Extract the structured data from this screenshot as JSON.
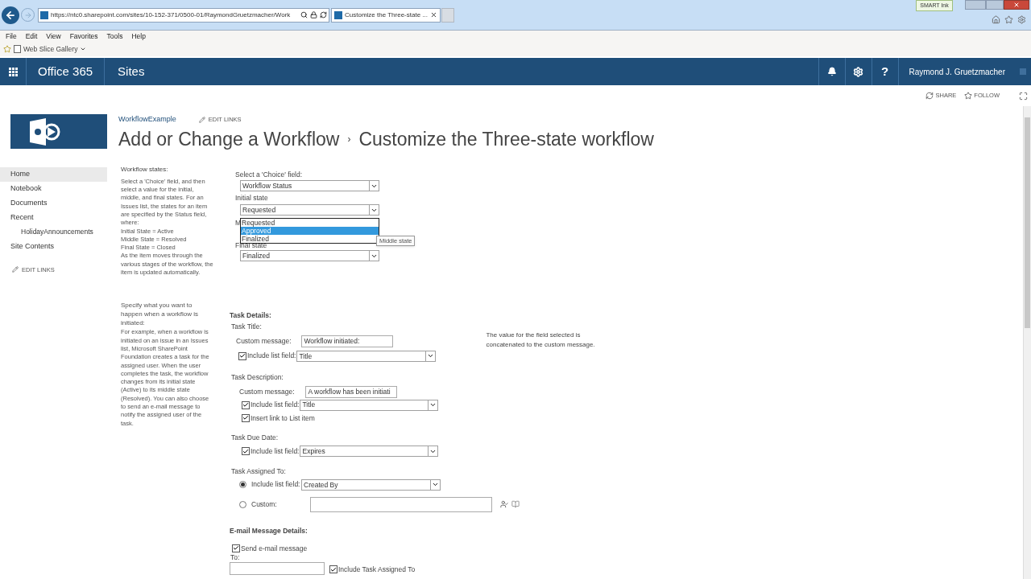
{
  "browser": {
    "url": "https://ntc0.sharepoint.com/sites/10-152-371/0500-01/RaymondGruetzmacher/Work",
    "tab_title": "Customize the Three-state ...",
    "smart_ink": "SMART Ink",
    "menu": [
      "File",
      "Edit",
      "View",
      "Favorites",
      "Tools",
      "Help"
    ],
    "favorites_item": "Web Slice Gallery"
  },
  "suite_bar": {
    "brand": "Office 365",
    "app": "Sites",
    "help": "?",
    "user": "Raymond J. Gruetzmacher"
  },
  "actions": [
    {
      "kind": "share",
      "label": "SHARE"
    },
    {
      "kind": "follow",
      "label": "FOLLOW"
    }
  ],
  "header": {
    "breadcrumb": "WorkflowExample",
    "edit_links": "EDIT LINKS",
    "title": "Add or Change a Workflow",
    "separator": "›",
    "subtitle": "Customize the Three-state workflow"
  },
  "nav": {
    "items": [
      {
        "label": "Home",
        "selected": true
      },
      {
        "label": "Notebook",
        "selected": false
      },
      {
        "label": "Documents",
        "selected": false
      },
      {
        "label": "Recent",
        "selected": false,
        "children": [
          {
            "label": "HolidayAnnouncements",
            "selected": false
          }
        ]
      },
      {
        "label": "Site Contents",
        "selected": false
      }
    ],
    "edit_links": "EDIT LINKS"
  },
  "states_section": {
    "heading": "Workflow states:",
    "description": [
      "Select a 'Choice' field, and then select a value for the initial, middle, and final states. For an Issues list, the states for an item are specified by the Status field, where:",
      "Initial State = Active",
      "Middle State = Resolved",
      "Final State = Closed",
      "As the item moves through the various stages of the workflow, the item is updated automatically."
    ],
    "choice_label": "Select a 'Choice' field:",
    "choice_value": "Workflow Status",
    "initial_label": "Initial state",
    "initial_value": "Requested",
    "middle_label": "M",
    "middle_options": [
      {
        "label": "Requested",
        "selected": false
      },
      {
        "label": "Approved",
        "selected": true
      },
      {
        "label": "Finalized",
        "selected": false
      }
    ],
    "tooltip": "Middle state",
    "final_label": "Final state",
    "final_value": "Finalized"
  },
  "task_section": {
    "intro": "Specify what you want to happen when a workflow is initiated:",
    "description": "For example, when a workflow is initiated on an issue in an Issues list, Microsoft SharePoint Foundation creates a task for the assigned user. When the user completes the task, the workflow changes from its initial state (Active) to its middle state (Resolved). You can also choose to send an e-mail message to notify the assigned user of the task.",
    "heading": "Task Details:",
    "task_title": {
      "label": "Task Title:",
      "message_label": "Custom message:",
      "message_value": "Workflow initiated:",
      "note": "The value for the field selected is concatenated to the custom message.",
      "include_label": "Include list field:",
      "include_checked": true,
      "include_value": "Title"
    },
    "task_description": {
      "label": "Task Description:",
      "message_label": "Custom message:",
      "message_value": "A workflow has been initiati",
      "include_label": "Include list field:",
      "include_checked": true,
      "include_value": "Title",
      "link_label": "Insert link to List item",
      "link_checked": true
    },
    "due_date": {
      "label": "Task Due Date:",
      "include_label": "Include list field:",
      "include_checked": true,
      "include_value": "Expires"
    },
    "assigned_to": {
      "label": "Task Assigned To:",
      "options": [
        {
          "label": "Include list field:",
          "selected": true,
          "value": "Created By"
        },
        {
          "label": "Custom:",
          "selected": false
        }
      ]
    }
  },
  "email_section": {
    "heading": "E-mail Message Details:",
    "send_label": "Send e-mail message",
    "send_checked": true,
    "to_label": "To:",
    "include_assigned_label": "Include Task Assigned To",
    "include_assigned_checked": true
  }
}
